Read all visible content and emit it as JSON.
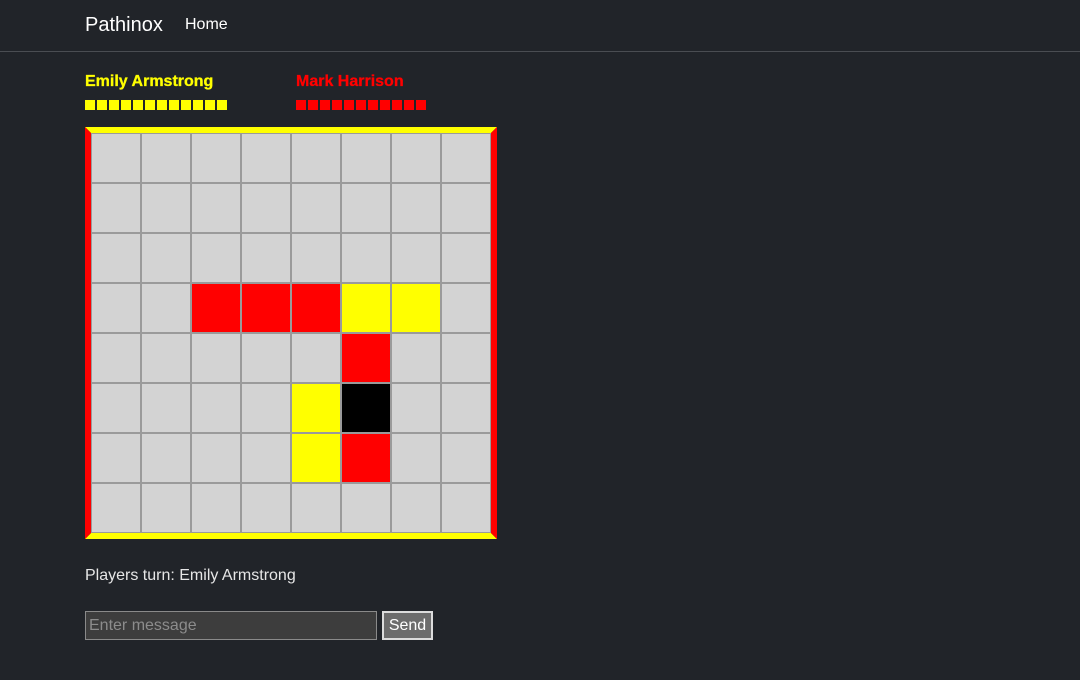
{
  "nav": {
    "brand": "Pathinox",
    "home": "Home"
  },
  "players": [
    {
      "name": "Emily Armstrong",
      "color": "#ffff00",
      "pieces_remaining": 12
    },
    {
      "name": "Mark Harrison",
      "color": "#ff0000",
      "pieces_remaining": 11
    }
  ],
  "board": {
    "size": 8,
    "edge_colors": {
      "top": "#ffff00",
      "bottom": "#ffff00",
      "left": "#ff0000",
      "right": "#ff0000"
    },
    "colors": {
      "empty": "#d3d3d3",
      "yellow": "#ffff00",
      "red": "#ff0000",
      "black": "#000000"
    },
    "cells": [
      [
        "empty",
        "empty",
        "empty",
        "empty",
        "empty",
        "empty",
        "empty",
        "empty"
      ],
      [
        "empty",
        "empty",
        "empty",
        "empty",
        "empty",
        "empty",
        "empty",
        "empty"
      ],
      [
        "empty",
        "empty",
        "empty",
        "empty",
        "empty",
        "empty",
        "empty",
        "empty"
      ],
      [
        "empty",
        "empty",
        "red",
        "red",
        "red",
        "yellow",
        "yellow",
        "empty"
      ],
      [
        "empty",
        "empty",
        "empty",
        "empty",
        "empty",
        "red",
        "empty",
        "empty"
      ],
      [
        "empty",
        "empty",
        "empty",
        "empty",
        "yellow",
        "black",
        "empty",
        "empty"
      ],
      [
        "empty",
        "empty",
        "empty",
        "empty",
        "yellow",
        "red",
        "empty",
        "empty"
      ],
      [
        "empty",
        "empty",
        "empty",
        "empty",
        "empty",
        "empty",
        "empty",
        "empty"
      ]
    ]
  },
  "turn": {
    "text": "Players turn: Emily Armstrong"
  },
  "chat": {
    "placeholder": "Enter message",
    "value": "",
    "send_label": "Send"
  }
}
